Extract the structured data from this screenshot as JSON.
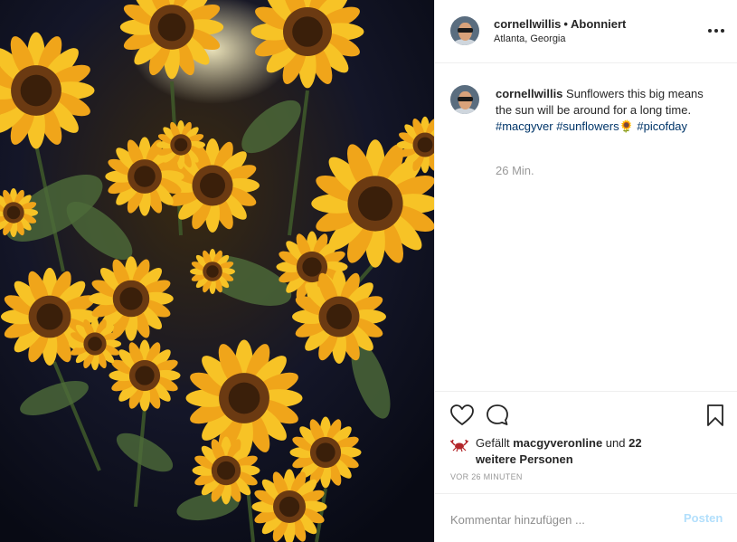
{
  "header": {
    "username": "cornellwillis",
    "separator": "•",
    "follow_status": "Abonniert",
    "location": "Atlanta, Georgia",
    "more_label": "•••"
  },
  "caption": {
    "username": "cornellwillis",
    "text": " Sunflowers this big means the sun will be around for a long time. ",
    "hashtags": [
      "#macgyver",
      "#sunflowers",
      "#picofday"
    ],
    "emoji": "🌻",
    "time": "26 Min."
  },
  "likes": {
    "prefix": "Gefällt ",
    "liker": "macgyveronline",
    "suffix": " und ",
    "others": "22 weitere Personen"
  },
  "timestamp": "VOR 26 MINUTEN",
  "comment": {
    "placeholder": "Kommentar hinzufügen ...",
    "post_label": "Posten"
  },
  "icons": {
    "like": "heart-icon",
    "comment": "comment-icon",
    "save": "bookmark-icon",
    "liker": "crab-icon",
    "more": "more-options-icon"
  },
  "colors": {
    "link": "#003569",
    "muted": "#999999",
    "post_disabled": "#b2dffc",
    "border": "#efefef"
  }
}
